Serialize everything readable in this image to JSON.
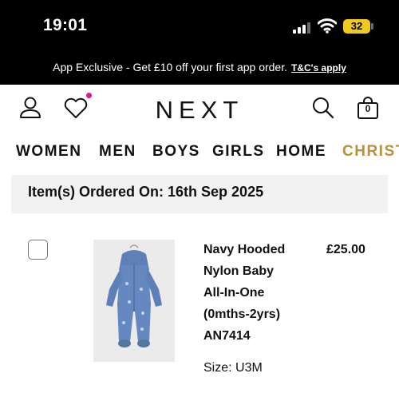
{
  "status_bar": {
    "time": "19:01",
    "battery": "32",
    "accent_color": "#f0c81e"
  },
  "promo": {
    "text": "App Exclusive - Get £10 off your first app order.",
    "link": "T&C's apply"
  },
  "header": {
    "logo": "NEXT",
    "bag_count": "0",
    "notification_color": "#e0197d"
  },
  "nav": {
    "items": [
      "WOMEN",
      "MEN",
      "BOYS",
      "GIRLS",
      "HOME",
      "CHRISTMAS"
    ],
    "accent_color": "#b8913a"
  },
  "order": {
    "ordered_on": "Item(s) Ordered On: 16th Sep 2025"
  },
  "product": {
    "title_lines": [
      "Navy Hooded",
      "Nylon Baby",
      "All-In-One",
      "(0mths-2yrs)",
      "AN7414"
    ],
    "price": "£25.00",
    "size": "Size: U3M"
  }
}
